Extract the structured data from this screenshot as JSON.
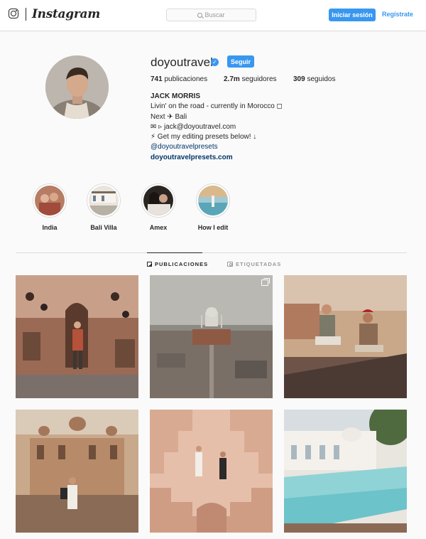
{
  "header": {
    "brand": "Instagram",
    "search_placeholder": "Buscar",
    "login_label": "Iniciar sesión",
    "signup_label": "Regístrate"
  },
  "profile": {
    "username": "doyoutravel",
    "verified_icon": "✓",
    "follow_label": "Seguir",
    "posts_count": "741",
    "posts_label": "publicaciones",
    "followers_count": "2.7m",
    "followers_label": "seguidores",
    "following_count": "309",
    "following_label": "seguidos",
    "full_name": "JACK MORRIS",
    "bio_lines": [
      "Livin' on the road - currently in Morocco ◻",
      "Next ✈ Bali",
      "✉ ▹ jack@doyoutravel.com",
      "⚡ Get my editing presets below! ↓"
    ],
    "link_handle": "@doyoutravelpresets",
    "website": "doyoutravelpresets.com"
  },
  "highlights": [
    {
      "label": "India"
    },
    {
      "label": "Bali Villa"
    },
    {
      "label": "Amex"
    },
    {
      "label": "How I edit"
    }
  ],
  "tabs": {
    "posts_label": "PUBLICACIONES",
    "tagged_label": "ETIQUETADAS"
  },
  "colors": {
    "accent": "#3897f0",
    "link": "#003569",
    "border": "#dbdbdb"
  }
}
